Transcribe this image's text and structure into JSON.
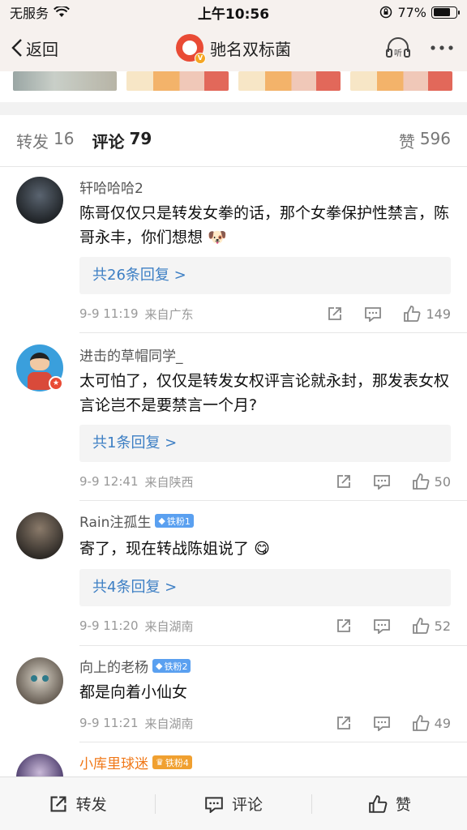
{
  "status_bar": {
    "carrier": "无服务",
    "time": "上午10:56",
    "battery": "77%",
    "battery_level": 0.77
  },
  "nav": {
    "back_label": "返回",
    "title": "驰名双标菌"
  },
  "tabs": {
    "repost": {
      "label": "转发",
      "count": "16"
    },
    "comment": {
      "label": "评论",
      "count": "79"
    },
    "like": {
      "label": "赞",
      "count": "596"
    }
  },
  "comments": [
    {
      "name": "轩哈哈哈2",
      "text": "陈哥仅仅只是转发女拳的话，那个女拳保护性禁言，陈哥永丰，你们想想",
      "emoji": "🐶",
      "reply": "共26条回复 >",
      "time": "9-9 11:19",
      "source": "来自广东",
      "likes": "149"
    },
    {
      "name": "进击的草帽同学_",
      "text": "太可怕了，仅仅是转发女权评言论就永封，那发表女权言论岂不是要禁言一个月?",
      "reply": "共1条回复 >",
      "time": "9-9 12:41",
      "source": "来自陕西",
      "likes": "50"
    },
    {
      "name": "Rain注孤生",
      "badge": "铁粉1",
      "text": "寄了，现在转战陈姐说了",
      "emoji": "😋",
      "reply": "共4条回复 >",
      "time": "9-9 11:20",
      "source": "来自湖南",
      "likes": "52"
    },
    {
      "name": "向上的老杨",
      "badge": "铁粉2",
      "text": "都是向着小仙女",
      "time": "9-9 11:21",
      "source": "来自湖南",
      "likes": "49"
    },
    {
      "name": "小库里球迷",
      "badge": "铁粉4"
    }
  ],
  "bottom_bar": {
    "repost_label": "转发",
    "comment_label": "评论",
    "like_label": "赞"
  },
  "colors": {
    "link_blue": "#3d7fc4",
    "nav_bg": "#f6f1ee",
    "brand_red": "#e94b35",
    "vip_orange": "#f07818"
  }
}
